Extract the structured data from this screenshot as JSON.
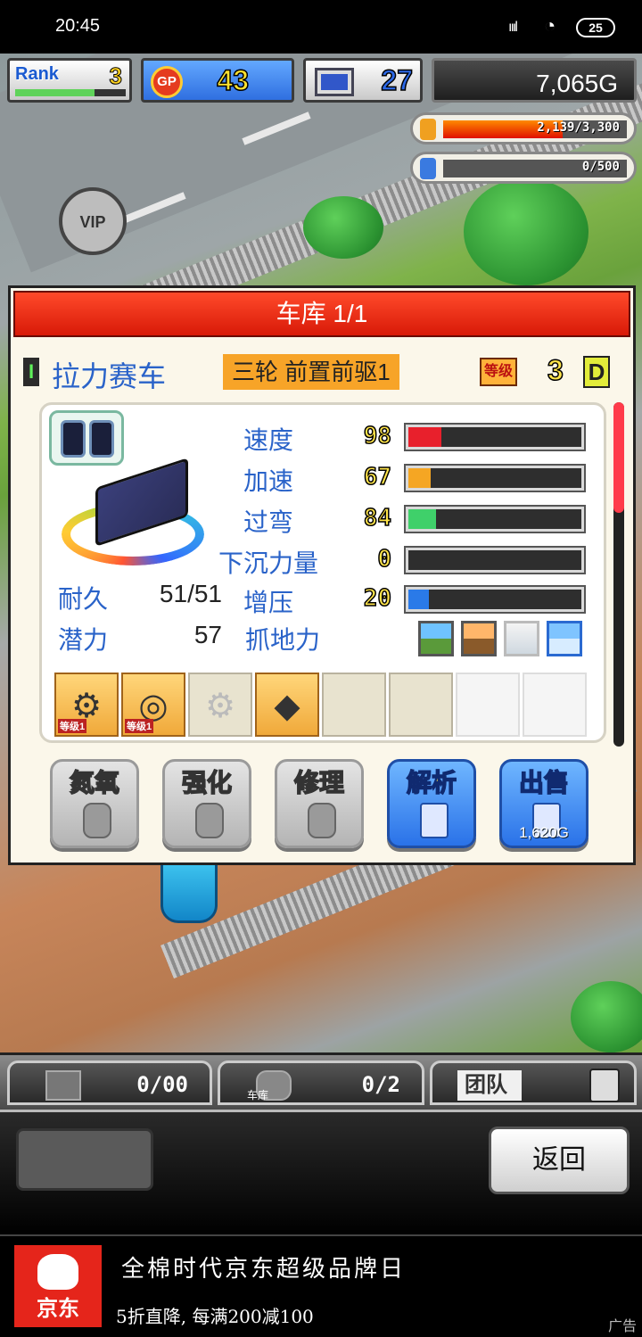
{
  "status_bar": {
    "time": "20:45",
    "signal": "ıııl",
    "wifi": "wifi-icon",
    "battery": "25"
  },
  "hud": {
    "rank_label": "Rank",
    "rank_value": "3",
    "rank_progress": 0.72,
    "gp_icon_label": "GP",
    "gp_value": "43",
    "research_value": "27",
    "money": "7,065G"
  },
  "resources": [
    {
      "icon": "fuel-can-icon",
      "text": "2,139/3,300",
      "fraction": 0.65,
      "color": "#f0a020"
    },
    {
      "icon": "bottle-icon",
      "text": "0/500",
      "fraction": 0.0,
      "color": "#3a7ae0"
    }
  ],
  "scene": {
    "vip_label": "VIP"
  },
  "garage": {
    "title": "车库 1/1",
    "car_index": "I",
    "car_name": "拉力赛车",
    "car_type": "三轮 前置前驱1",
    "level_label": "等级",
    "level_value": "3",
    "grade": "D",
    "stats": [
      {
        "label": "速度",
        "value": "98",
        "fraction": 0.19,
        "color": "#e8202c"
      },
      {
        "label": "加速",
        "value": "67",
        "fraction": 0.13,
        "color": "#f5a623"
      },
      {
        "label": "过弯",
        "value": "84",
        "fraction": 0.16,
        "color": "#3fd06a"
      },
      {
        "label": "下沉力量",
        "value": "0",
        "fraction": 0.0,
        "color": "#888888"
      },
      {
        "label": "增压",
        "value": "20",
        "fraction": 0.12,
        "color": "#2a7ae8"
      }
    ],
    "durability_label": "耐久",
    "durability_value": "51/51",
    "potential_label": "潜力",
    "potential_value": "57",
    "grip_label": "抓地力",
    "grip_icons": [
      "tarmac-grip-icon",
      "dirt-grip-icon",
      "snow-grip-icon",
      "mountain-grip-icon"
    ],
    "parts": [
      {
        "icon": "engine-icon",
        "level": "等级1",
        "state": "filled"
      },
      {
        "icon": "tire-icon",
        "level": "等级1",
        "state": "filled"
      },
      {
        "icon": "gear-part-icon",
        "level": "",
        "state": "locked"
      },
      {
        "icon": "oil-can-icon",
        "level": "",
        "state": "filled"
      },
      {
        "icon": "",
        "level": "",
        "state": "empty"
      },
      {
        "icon": "",
        "level": "",
        "state": "empty"
      },
      {
        "icon": "",
        "level": "",
        "state": "empty-white"
      },
      {
        "icon": "",
        "level": "",
        "state": "empty-white"
      }
    ],
    "actions": [
      {
        "label": "氮氧",
        "icon": "nitro-bottle-icon",
        "style": "gray"
      },
      {
        "label": "强化",
        "icon": "egg-icon",
        "style": "gray"
      },
      {
        "label": "修理",
        "icon": "wrench-gear-icon",
        "style": "gray"
      },
      {
        "label": "解析",
        "icon": "computer-ex-icon",
        "style": "blue"
      },
      {
        "label": "出售",
        "icon": "money-bag-icon",
        "style": "blue",
        "price": "1,620G"
      }
    ]
  },
  "tabs": {
    "items_count": "0/00",
    "garage_caption": "车库",
    "garage_count": "0/2",
    "team_label": "团队"
  },
  "footer": {
    "back_label": "返回"
  },
  "ad": {
    "logo_text": "京东",
    "title": "全棉时代京东超级品牌日",
    "subtitle": "5折直降, 每满200减100",
    "tag": "广告"
  }
}
